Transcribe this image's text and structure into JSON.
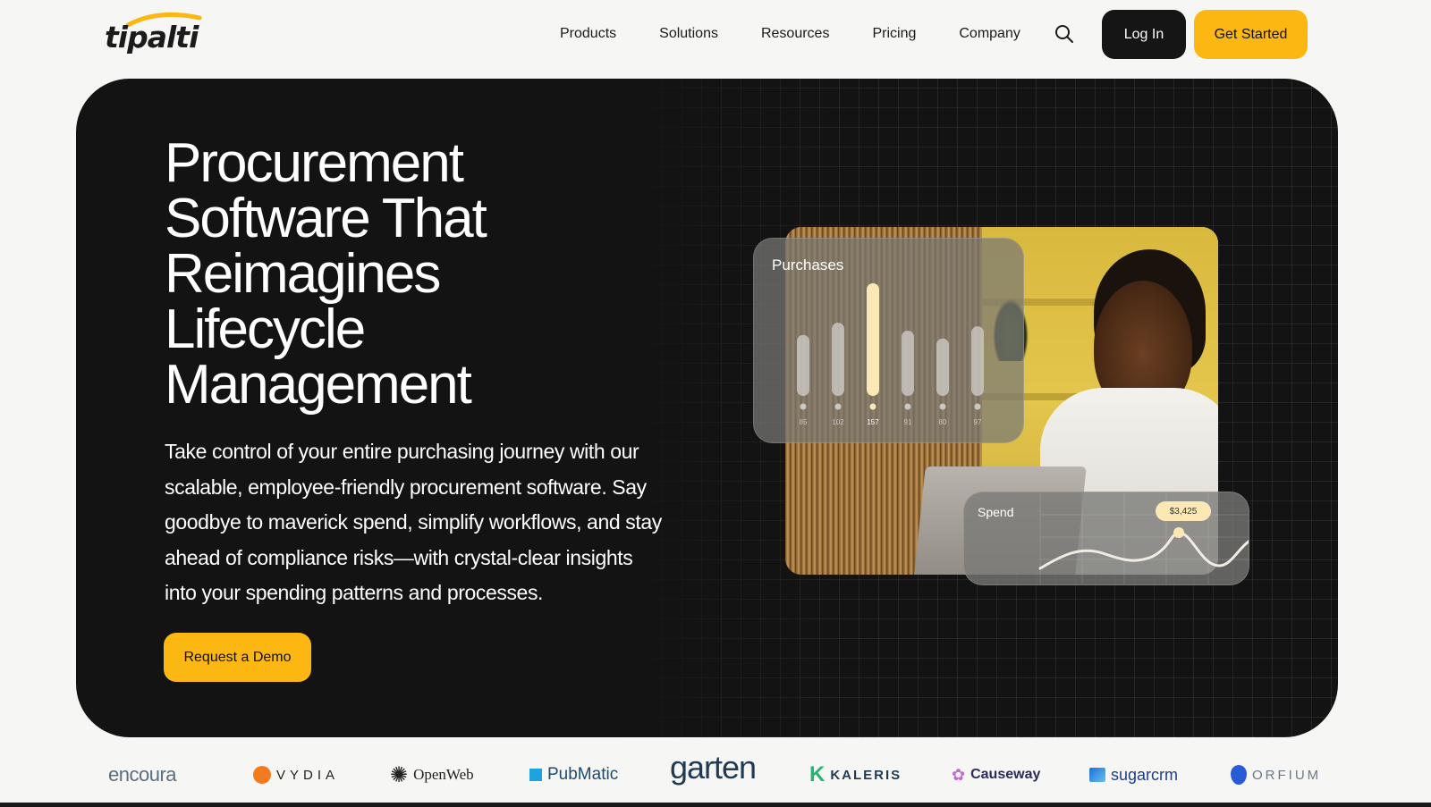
{
  "header": {
    "logo_text": "tipalti",
    "nav": [
      "Products",
      "Solutions",
      "Resources",
      "Pricing",
      "Company"
    ],
    "login_label": "Log In",
    "get_started_label": "Get Started"
  },
  "hero": {
    "title_lines": [
      "Procurement",
      "Software That",
      "Reimagines",
      "Lifecycle",
      "Management"
    ],
    "description": "Take control of your entire purchasing journey with our scalable, employee-friendly procurement software. Say goodbye to maverick spend, simplify workflows, and stay ahead of compliance risks—with crystal-clear insights into your spending patterns and processes.",
    "cta_label": "Request a Demo"
  },
  "purchases_card": {
    "title": "Purchases",
    "values": [
      85,
      102,
      157,
      91,
      80,
      97
    ],
    "labels": [
      "85",
      "102",
      "157",
      "91",
      "80",
      "97"
    ],
    "highlight_index": 2
  },
  "spend_card": {
    "title": "Spend",
    "badge": "$3,425"
  },
  "customer_logos": [
    "encoura",
    "VYDIA",
    "OpenWeb",
    "PubMatic",
    "garten",
    "KALERIS",
    "Causeway",
    "sugarcrm",
    "ORFIUM"
  ],
  "colors": {
    "accent": "#fdb713",
    "hero_bg": "#131313",
    "page_bg": "#f6f6f5"
  }
}
